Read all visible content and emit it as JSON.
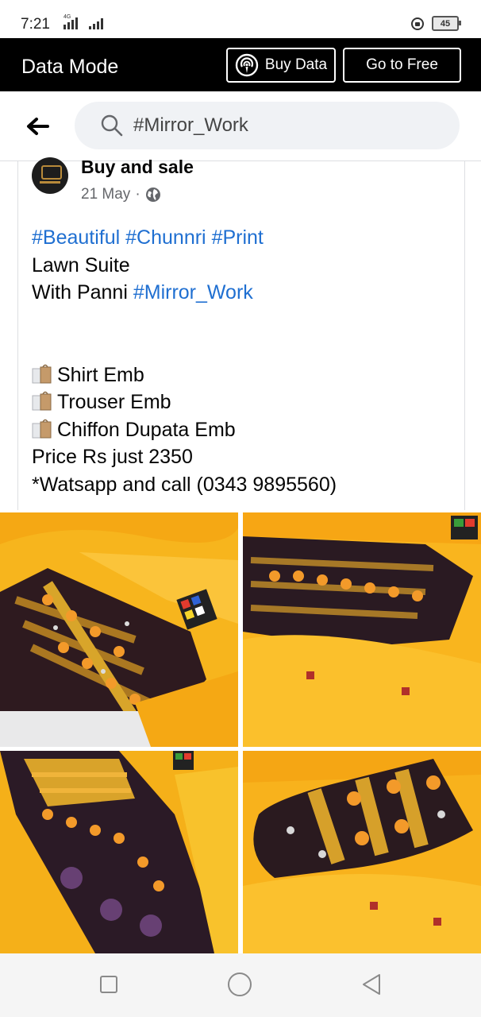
{
  "status_bar": {
    "time": "7:21",
    "network": "4G",
    "battery": "45"
  },
  "data_mode_bar": {
    "title": "Data Mode",
    "buy_data_label": "Buy Data",
    "go_to_free_label": "Go to Free",
    "background": "#000000"
  },
  "search": {
    "query": "#Mirror_Work"
  },
  "post": {
    "author": "Buy and sale",
    "date": "21 May",
    "separator": "·",
    "privacy_icon": "globe-icon",
    "hashtags_line1": [
      "#Beautiful",
      "#Chunnri",
      "#Print"
    ],
    "line2": "Lawn Suite",
    "line3_prefix": "With Panni ",
    "line3_hashtag": "#Mirror_Work",
    "items": [
      "Shirt Emb",
      "Trouser Emb",
      "Chiffon Dupata Emb"
    ],
    "price_line": "Price Rs just 2350",
    "contact_line": "*Watsapp and call (0343 9895560)",
    "hashtag_color": "#1f6fd1"
  },
  "photos": [
    {
      "subject": "yellow embroidered suit with mirror work and rubik's cube"
    },
    {
      "subject": "yellow embroidered suit folded with dupatta"
    },
    {
      "subject": "yellow embroidered suit front panel"
    },
    {
      "subject": "rolled embroidered fabric with mirror work"
    }
  ],
  "nav_bar": {
    "icons": [
      "recent-apps-icon",
      "home-icon",
      "back-icon"
    ]
  }
}
